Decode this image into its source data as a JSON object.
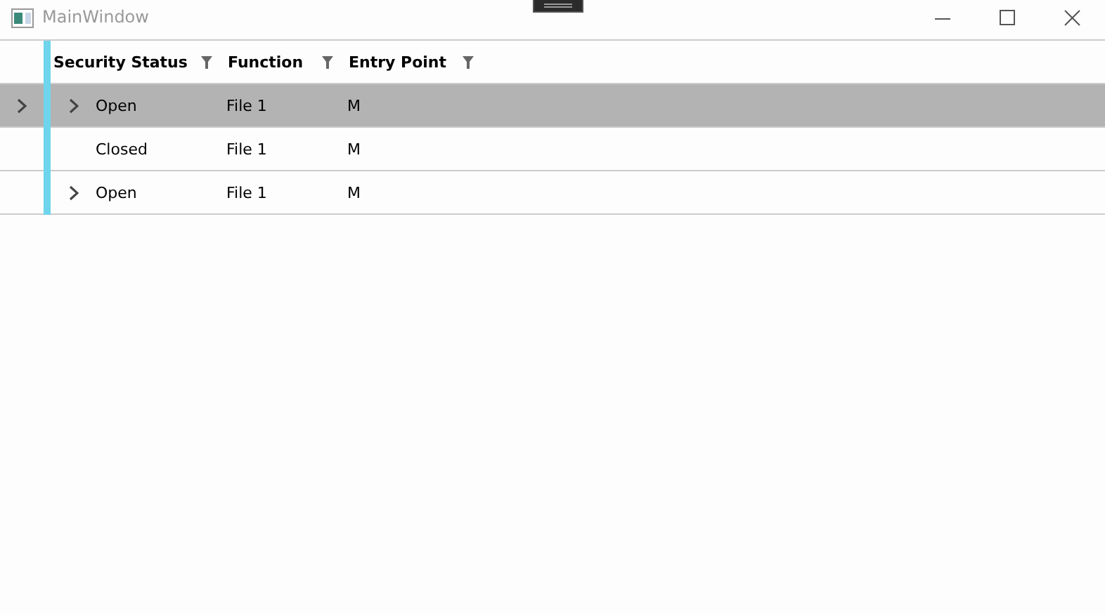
{
  "window": {
    "title": "MainWindow"
  },
  "table": {
    "columns": [
      {
        "label": "Security Status"
      },
      {
        "label": "Function"
      },
      {
        "label": "Entry Point"
      }
    ],
    "rows": [
      {
        "selected": true,
        "expandable": true,
        "cells": [
          "Open",
          "File 1",
          "M"
        ]
      },
      {
        "selected": false,
        "expandable": false,
        "cells": [
          "Closed",
          "File 1",
          "M"
        ]
      },
      {
        "selected": false,
        "expandable": true,
        "cells": [
          "Open",
          "File 1",
          "M"
        ]
      }
    ]
  }
}
